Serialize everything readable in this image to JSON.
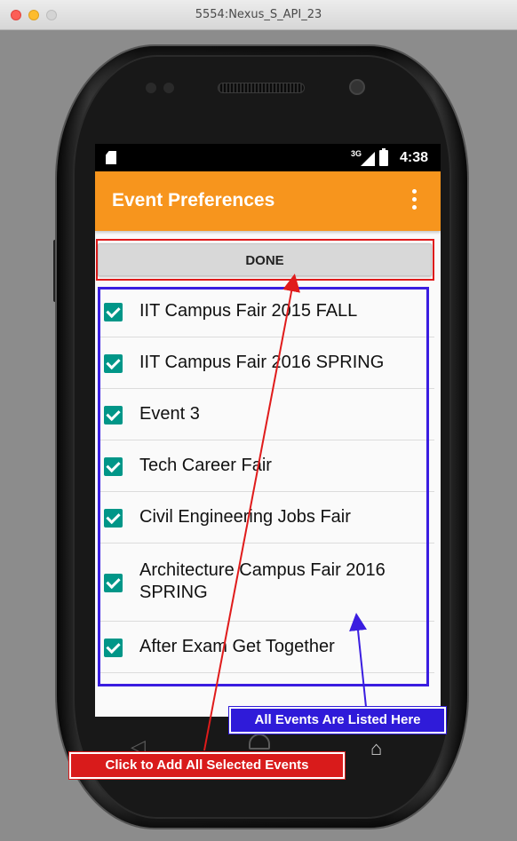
{
  "window": {
    "title": "5554:Nexus_S_API_23"
  },
  "statusbar": {
    "network": "3G",
    "time": "4:38"
  },
  "appbar": {
    "title": "Event Preferences",
    "overflow_icon": "more-vert-icon"
  },
  "done_button": {
    "label": "DONE"
  },
  "events": [
    {
      "label": "IIT Campus Fair 2015 FALL",
      "checked": true
    },
    {
      "label": "IIT Campus Fair 2016 SPRING",
      "checked": true
    },
    {
      "label": "Event 3",
      "checked": true
    },
    {
      "label": "Tech Career Fair",
      "checked": true
    },
    {
      "label": "Civil Engineering Jobs Fair",
      "checked": true
    },
    {
      "label": "Architecture Campus Fair 2016 SPRING",
      "checked": true
    },
    {
      "label": "After Exam Get Together",
      "checked": true
    }
  ],
  "annotations": {
    "events_listed": "All Events Are Listed Here",
    "click_to_add": "Click to Add All Selected Events"
  },
  "colors": {
    "appbar": "#f7951d",
    "checkbox": "#009688",
    "done_highlight": "#e01b1b",
    "list_highlight": "#3a1de0"
  }
}
